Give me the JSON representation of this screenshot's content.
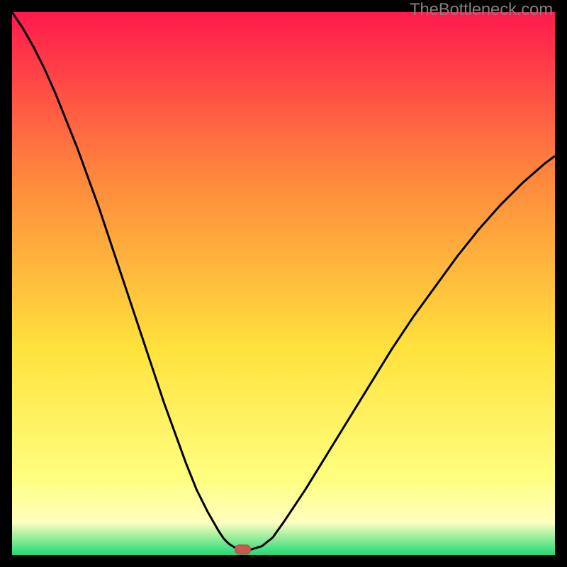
{
  "attribution": "TheBottleneck.com",
  "colors": {
    "frame": "#000000",
    "grad_top": "#ff1a4d",
    "grad_mid1": "#ff863d",
    "grad_mid2": "#ffe23d",
    "grad_mid3": "#ffff80",
    "grad_mid4": "#ffffc0",
    "grad_bottom": "#22d973",
    "curve": "#000000",
    "marker_fill": "#c9594e",
    "marker_stroke": "#b24a40"
  },
  "chart_data": {
    "type": "line",
    "title": "",
    "xlabel": "",
    "ylabel": "",
    "xlim": [
      0,
      100
    ],
    "ylim": [
      0,
      100
    ],
    "x": [
      0,
      2,
      4,
      6,
      8,
      10,
      12,
      14,
      16,
      18,
      20,
      22,
      24,
      26,
      28,
      30,
      32,
      34,
      36,
      38,
      39,
      40,
      41,
      42,
      43,
      44,
      46,
      48,
      50,
      54,
      58,
      62,
      66,
      70,
      74,
      78,
      82,
      86,
      90,
      94,
      98,
      100
    ],
    "values": [
      100,
      97,
      93.5,
      89.5,
      85,
      80,
      75,
      69.5,
      64,
      58,
      52,
      46,
      40,
      34,
      28,
      22.5,
      17,
      12,
      8,
      4.5,
      3,
      2,
      1.4,
      1,
      1,
      1,
      1.6,
      3.2,
      6,
      12,
      18.5,
      25,
      31.5,
      38,
      44,
      49.5,
      55,
      60,
      64.5,
      68.5,
      72,
      73.5
    ],
    "marker": {
      "x": 42.5,
      "y": 1
    },
    "notes": "V-shaped bottleneck curve; y is bottleneck percentage, x is a component balance parameter. Axes are unlabeled in the source image; values estimated from curve geometry on 0–100 scale."
  }
}
